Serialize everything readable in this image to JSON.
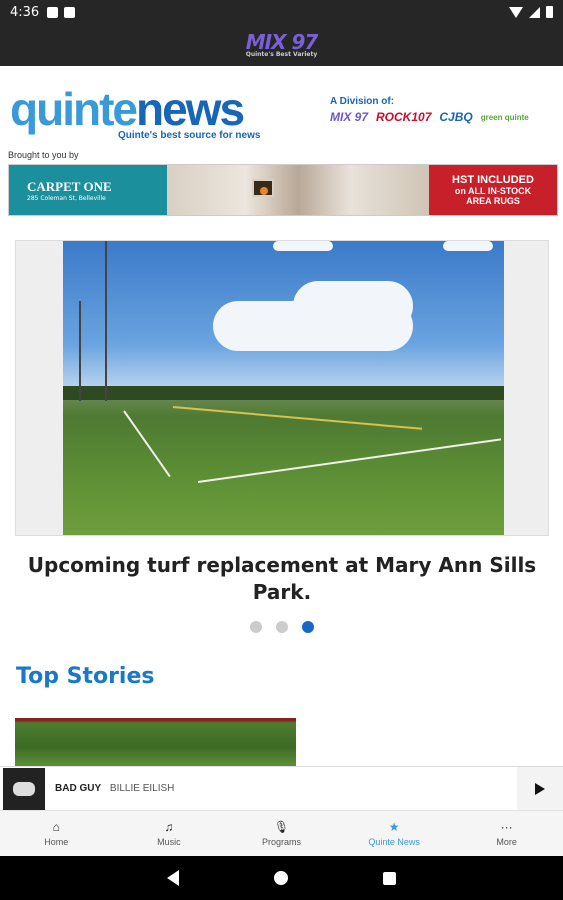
{
  "status_bar": {
    "time": "4:36"
  },
  "app_header": {
    "logo_text": "MIX 97",
    "logo_sub": "Quinte's Best Variety"
  },
  "masthead": {
    "logo_part1": "quinte",
    "logo_part2": "news",
    "tagline": "Quinte's best source for news",
    "division_label": "A Division of:",
    "stations": [
      "MIX 97",
      "ROCK107",
      "CJBQ",
      "green quinte"
    ],
    "brought_by": "Brought to you by"
  },
  "ad": {
    "brand": "CARPET ONE",
    "address": "285 Coleman St, Belleville",
    "headline_1": "HST INCLUDED",
    "headline_2": "on ALL IN-STOCK",
    "headline_3": "AREA RUGS"
  },
  "carousel": {
    "caption": "Upcoming turf replacement at Mary Ann Sills Park.",
    "dot_count": 3,
    "active_index": 2
  },
  "top_stories": {
    "title": "Top Stories"
  },
  "player": {
    "track": "BAD GUY",
    "artist": "BILLIE EILISH"
  },
  "bottom_nav": {
    "items": [
      {
        "label": "Home",
        "icon": "home-icon",
        "glyph": "⌂"
      },
      {
        "label": "Music",
        "icon": "music-icon",
        "glyph": "♫"
      },
      {
        "label": "Programs",
        "icon": "mic-icon",
        "glyph": "🎙"
      },
      {
        "label": "Quinte News",
        "icon": "star-icon",
        "glyph": "★"
      },
      {
        "label": "More",
        "icon": "more-icon",
        "glyph": "···"
      }
    ],
    "active_index": 3
  },
  "colors": {
    "accent": "#1a78c8",
    "nav_active": "#3a9ad9",
    "ad_red": "#c8202a",
    "ad_teal": "#1c8f9d"
  }
}
